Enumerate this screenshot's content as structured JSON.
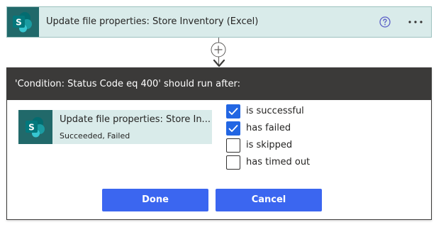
{
  "action_card": {
    "title": "Update file properties: Store Inventory (Excel)",
    "icon": "sharepoint-icon",
    "help_icon": "help-circle-icon",
    "more_icon": "more-ellipsis-icon"
  },
  "connector": {
    "add_icon": "plus-circle-icon",
    "arrow_icon": "arrow-down-icon"
  },
  "dialog": {
    "title": "'Condition: Status Code eq 400' should run after:",
    "previous_action": {
      "name": "Update file properties: Store In...",
      "status": "Succeeded, Failed",
      "icon": "sharepoint-icon"
    },
    "options": [
      {
        "label": "is successful",
        "checked": true
      },
      {
        "label": "has failed",
        "checked": true
      },
      {
        "label": "is skipped",
        "checked": false
      },
      {
        "label": "has timed out",
        "checked": false
      }
    ],
    "done_label": "Done",
    "cancel_label": "Cancel"
  },
  "colors": {
    "sharepoint_tile": "#21696a",
    "card_background": "#d9ebea",
    "dialog_header": "#3b3a39",
    "primary_button": "#3b66f0",
    "checkbox_checked": "#2266e3",
    "help_icon": "#5b5fc7"
  }
}
